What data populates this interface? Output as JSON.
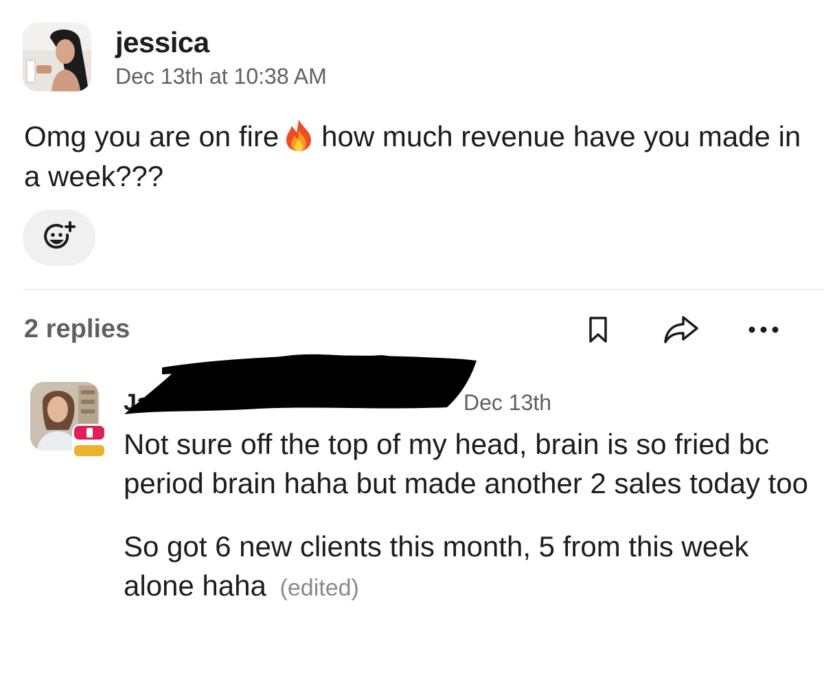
{
  "post": {
    "author": "jessica",
    "timestamp": "Dec 13th at 10:38 AM",
    "text_before_emoji": "Omg you are on fire",
    "emoji": "fire-emoji",
    "text_after_emoji": "how much revenue have you made in a week???",
    "add_reaction_icon": "add-reaction-icon"
  },
  "thread_bar": {
    "replies_label": "2 replies",
    "icons": [
      "bookmark-icon",
      "share-arrow-icon",
      "more-icon"
    ]
  },
  "reply": {
    "author": "Ja",
    "author_redacted": true,
    "timestamp": "Dec 13th",
    "paragraph_1": "Not sure off the top of my head, brain is so fried bc period brain haha but made another 2 sales today too",
    "paragraph_2": "So got 6 new clients this month, 5 from this week alone haha",
    "edited_label": "(edited)"
  },
  "colors": {
    "text": "#1d1c1d",
    "muted": "#616061",
    "reaction_pill": "#f0f0f0",
    "divider": "#e2e2e2",
    "redaction": "#000000",
    "badge_red": "#e01e5a",
    "badge_yellow": "#ecb22e"
  }
}
